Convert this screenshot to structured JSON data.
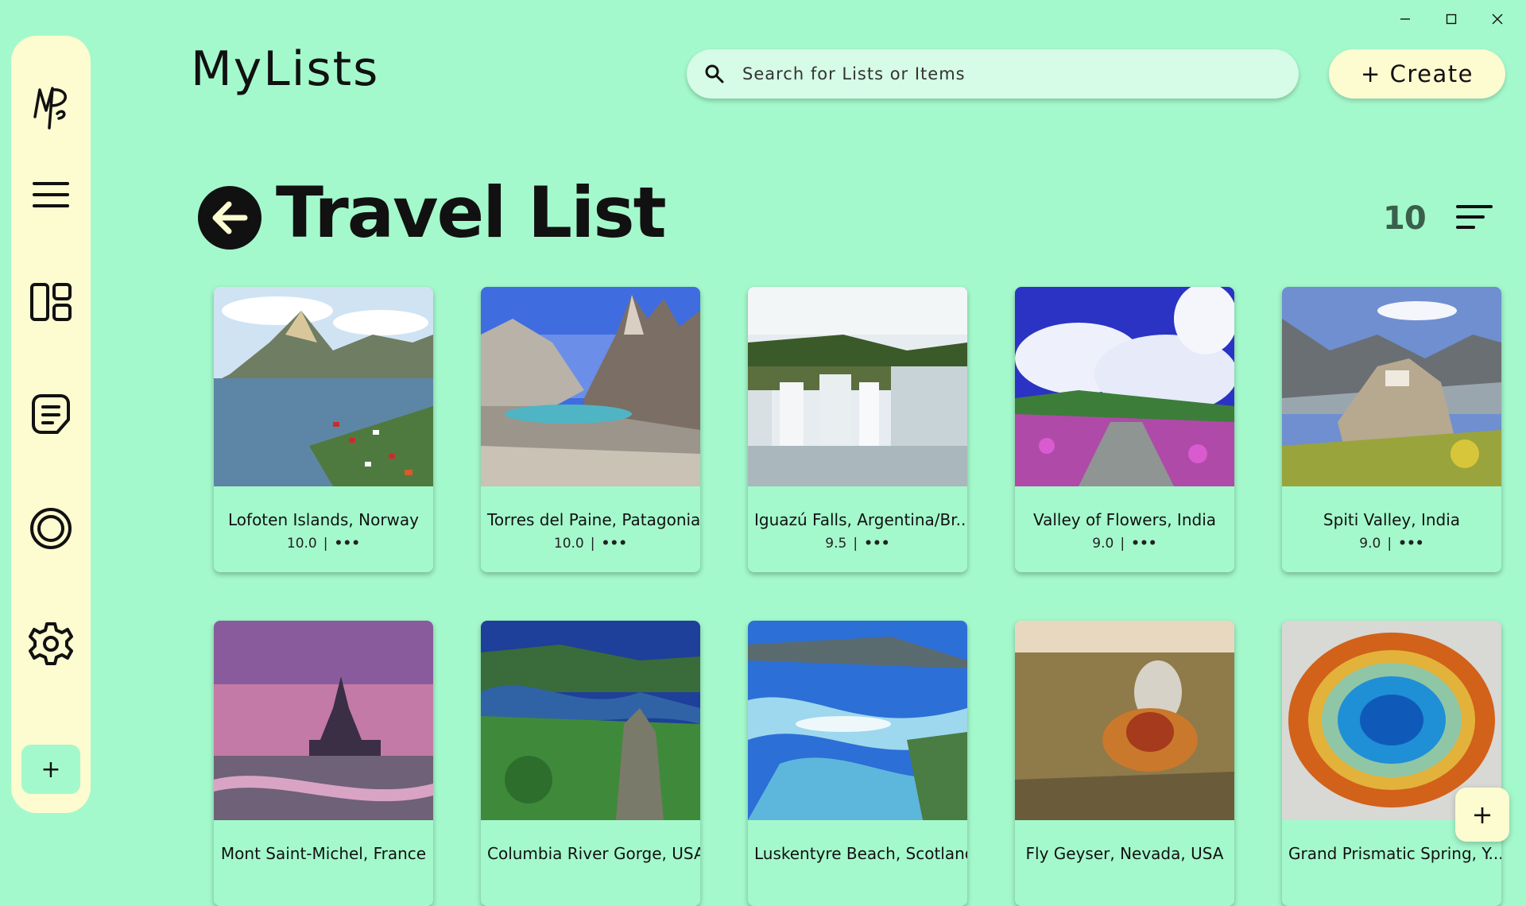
{
  "window": {
    "controls": [
      "minimize-icon",
      "maximize-icon",
      "close-icon"
    ]
  },
  "sidebar": {
    "logo": "MP",
    "items": [
      {
        "name": "menu",
        "icon": "hamburger-icon"
      },
      {
        "name": "dashboard",
        "icon": "dashboard-icon"
      },
      {
        "name": "notes",
        "icon": "notes-icon"
      },
      {
        "name": "circle",
        "icon": "ring-icon"
      },
      {
        "name": "settings",
        "icon": "gear-icon"
      }
    ],
    "add_label": "+"
  },
  "header": {
    "app_title": "MyLists",
    "search_placeholder": "Search for Lists or Items",
    "create_label": "+ Create"
  },
  "list": {
    "title": "Travel List",
    "count": "10"
  },
  "items": [
    {
      "name": "Lofoten Islands, Norway",
      "rating": "10.0",
      "sep": "|",
      "more": "•••"
    },
    {
      "name": "Torres del Paine, Patagonia",
      "rating": "10.0",
      "sep": "|",
      "more": "•••"
    },
    {
      "name": "Iguazú Falls, Argentina/Br...",
      "rating": "9.5",
      "sep": "|",
      "more": "•••"
    },
    {
      "name": "Valley of Flowers, India",
      "rating": "9.0",
      "sep": "|",
      "more": "•••"
    },
    {
      "name": "Spiti Valley, India",
      "rating": "9.0",
      "sep": "|",
      "more": "•••"
    },
    {
      "name": "Mont Saint-Michel, France",
      "rating": "",
      "sep": "",
      "more": ""
    },
    {
      "name": "Columbia River Gorge, USA",
      "rating": "",
      "sep": "",
      "more": ""
    },
    {
      "name": "Luskentyre Beach, Scotland",
      "rating": "",
      "sep": "",
      "more": ""
    },
    {
      "name": "Fly Geyser, Nevada, USA",
      "rating": "",
      "sep": "",
      "more": ""
    },
    {
      "name": "Grand Prismatic Spring, Y...",
      "rating": "",
      "sep": "",
      "more": ""
    }
  ],
  "fab_label": "+",
  "colors": {
    "background": "#a4f9cc",
    "panel": "#fdfbd0",
    "search": "#d6fbe6",
    "count": "#3a5f4c"
  }
}
